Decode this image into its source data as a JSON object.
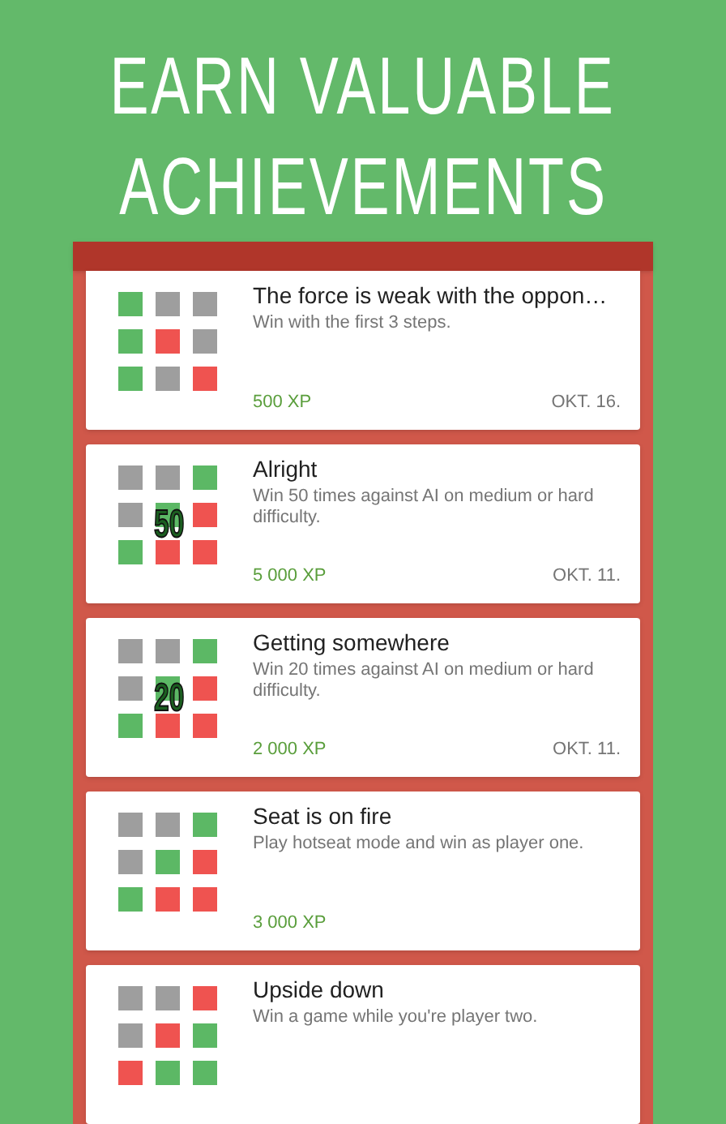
{
  "headline": [
    "EARN VALUABLE",
    "ACHIEVEMENTS"
  ],
  "achievements": [
    {
      "title": "The force is weak with the oppon…",
      "description": "Win with the first 3 steps.",
      "xp": "500 XP",
      "date": "OKT. 16.",
      "cells": [
        {
          "color": "#5cb865"
        },
        {
          "color": "#9e9e9e"
        },
        {
          "color": "#9e9e9e"
        },
        {
          "color": "#5cb865"
        },
        {
          "color": "#ef5350"
        },
        {
          "color": "#9e9e9e"
        },
        {
          "color": "#5cb865"
        },
        {
          "color": "#9e9e9e"
        },
        {
          "color": "#ef5350"
        }
      ]
    },
    {
      "title": "Alright",
      "description": "Win 50 times against AI on medium or hard difficulty.",
      "xp": "5 000 XP",
      "date": "OKT. 11.",
      "badge": "50",
      "cells": [
        {
          "color": "#9e9e9e"
        },
        {
          "color": "#9e9e9e"
        },
        {
          "color": "#5cb865"
        },
        {
          "color": "#9e9e9e"
        },
        {
          "color": "#5cb865"
        },
        {
          "color": "#ef5350"
        },
        {
          "color": "#5cb865"
        },
        {
          "color": "#ef5350"
        },
        {
          "color": "#ef5350"
        }
      ]
    },
    {
      "title": "Getting somewhere",
      "description": "Win 20 times against AI on medium or hard difficulty.",
      "xp": "2 000 XP",
      "date": "OKT. 11.",
      "badge": "20",
      "cells": [
        {
          "color": "#9e9e9e"
        },
        {
          "color": "#9e9e9e"
        },
        {
          "color": "#5cb865"
        },
        {
          "color": "#9e9e9e"
        },
        {
          "color": "#5cb865"
        },
        {
          "color": "#ef5350"
        },
        {
          "color": "#5cb865"
        },
        {
          "color": "#ef5350"
        },
        {
          "color": "#ef5350"
        }
      ]
    },
    {
      "title": "Seat is on fire",
      "description": "Play hotseat mode and win as player one.",
      "xp": "3 000 XP",
      "cells": [
        {
          "color": "#9e9e9e"
        },
        {
          "color": "#9e9e9e"
        },
        {
          "color": "#5cb865"
        },
        {
          "color": "#9e9e9e"
        },
        {
          "color": "#5cb865"
        },
        {
          "color": "#ef5350"
        },
        {
          "color": "#5cb865"
        },
        {
          "color": "#ef5350"
        },
        {
          "color": "#ef5350"
        }
      ]
    },
    {
      "title": "Upside down",
      "description": "Win a game while you're player two.",
      "cells": [
        {
          "color": "#9e9e9e"
        },
        {
          "color": "#9e9e9e"
        },
        {
          "color": "#ef5350"
        },
        {
          "color": "#9e9e9e"
        },
        {
          "color": "#ef5350"
        },
        {
          "color": "#5cb865"
        },
        {
          "color": "#ef5350"
        },
        {
          "color": "#5cb865"
        },
        {
          "color": "#5cb865"
        }
      ]
    }
  ]
}
